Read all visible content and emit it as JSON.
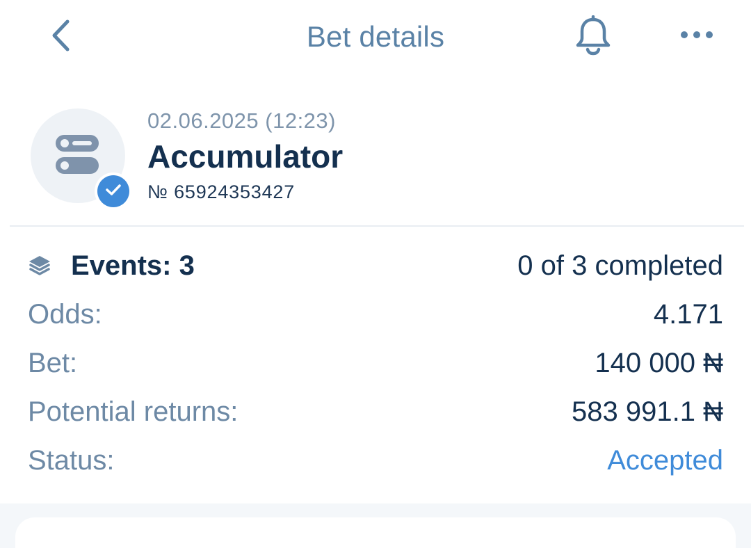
{
  "header": {
    "title": "Bet details",
    "back_icon": "chevron-left-icon",
    "bell_icon": "bell-icon",
    "more_icon": "more-horizontal-icon"
  },
  "bet": {
    "date": "02.06.2025 (12:23)",
    "type": "Accumulator",
    "number": "№ 65924353427",
    "icon": "accumulator-icon",
    "badge_icon": "check-icon"
  },
  "details": {
    "events_label": "Events: 3",
    "events_icon": "layers-icon",
    "events_progress": "0 of 3 completed",
    "odds_label": "Odds:",
    "odds_value": "4.171",
    "bet_label": "Bet:",
    "bet_value": "140 000 ₦",
    "returns_label": "Potential returns:",
    "returns_value": "583 991.1 ₦",
    "status_label": "Status:",
    "status_value": "Accepted"
  },
  "colors": {
    "accent": "#3f8bd9",
    "title": "#5a82a6",
    "text_dark": "#14304f",
    "text_muted": "#6d89a5"
  }
}
